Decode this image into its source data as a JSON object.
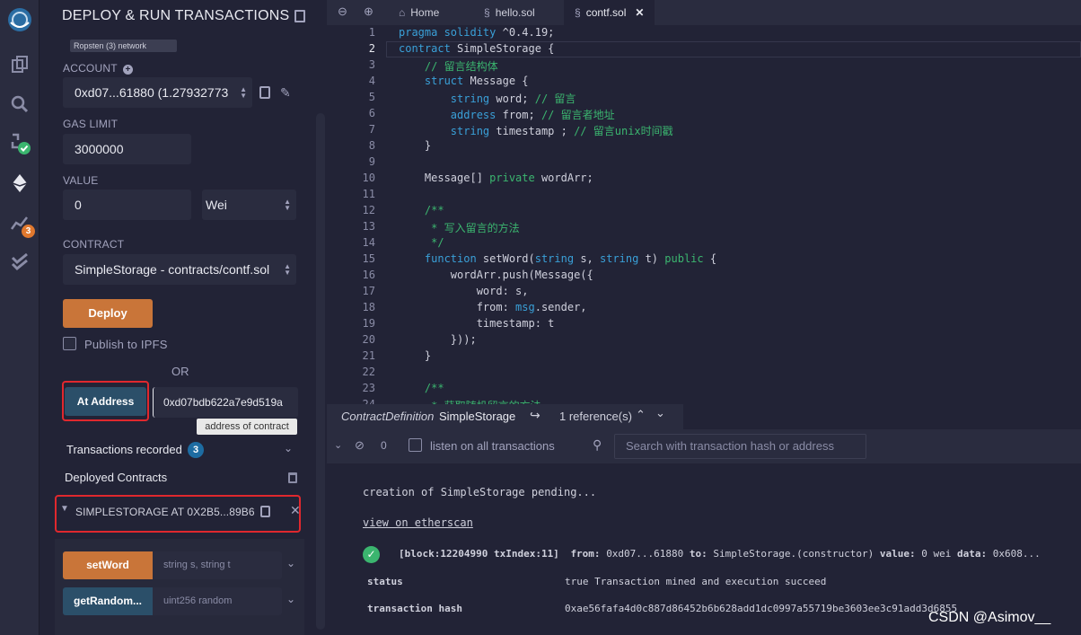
{
  "panel": {
    "title": "DEPLOY & RUN TRANSACTIONS",
    "environment_snippet": "Ropsten (3) network",
    "account_label": "ACCOUNT",
    "account_value": "0xd07...61880 (1.27932773",
    "gas_limit_label": "GAS LIMIT",
    "gas_limit_value": "3000000",
    "value_label": "VALUE",
    "value_amount": "0",
    "value_unit": "Wei",
    "contract_label": "CONTRACT",
    "contract_value": "SimpleStorage - contracts/contf.sol",
    "deploy_label": "Deploy",
    "publish_label": "Publish to IPFS",
    "or_label": "OR",
    "at_address_label": "At Address",
    "at_address_value": "0xd07bdb622a7e9d519a",
    "tooltip": "address of contract",
    "transactions_label": "Transactions recorded",
    "transactions_count": "3",
    "deployed_label": "Deployed Contracts",
    "instance_label": "SIMPLESTORAGE AT 0X2B5...89B6",
    "functions": [
      {
        "name": "setWord",
        "params": "string s, string t",
        "color": "#c97539"
      },
      {
        "name": "getRandom...",
        "params": "uint256 random",
        "color": "#2b4f69"
      }
    ]
  },
  "tabs": [
    {
      "label": "Home"
    },
    {
      "label": "hello.sol"
    },
    {
      "label": "contf.sol"
    }
  ],
  "editor": {
    "line_numbers": [
      "1",
      "2",
      "3",
      "4",
      "5",
      "6",
      "7",
      "8",
      "9",
      "10",
      "11",
      "12",
      "13",
      "14",
      "15",
      "16",
      "17",
      "18",
      "19",
      "20",
      "21",
      "22",
      "23",
      "24"
    ]
  },
  "editor_bar": {
    "definition_kind": "ContractDefinition",
    "definition_name": "SimpleStorage",
    "references": "1 reference(s)"
  },
  "terminal": {
    "count": "0",
    "listen_label": "listen on all transactions",
    "search_placeholder": "Search with transaction hash or address",
    "pending": "creation of SimpleStorage pending...",
    "etherscan": "view on etherscan",
    "block_info": "[block:12204990 txIndex:11]",
    "from_label": "from:",
    "from_value": "0xd07...61880",
    "to_label": "to:",
    "to_value": "SimpleStorage.(constructor)",
    "value_label": "value:",
    "value_value": "0 wei",
    "data_label": "data:",
    "data_value": "0x608...",
    "status_key": "status",
    "status_value": "true Transaction mined and execution succeed",
    "hash_key": "transaction hash",
    "hash_value": "0xae56fafa4d0c887d86452b6b628add1dc0997a55719be3603ee3c91add3d6855"
  },
  "watermark": "CSDN @Asimov__"
}
